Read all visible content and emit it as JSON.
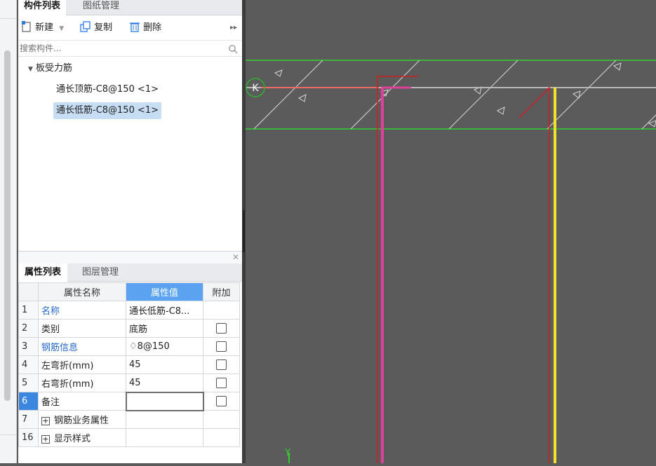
{
  "top_tabs": [
    "构件列表",
    "图纸管理"
  ],
  "toolbar": {
    "new_label": "新建",
    "copy_label": "复制",
    "delete_label": "删除"
  },
  "search": {
    "placeholder": "搜索构件..."
  },
  "tree": {
    "group": "板受力筋",
    "items": [
      "通长顶筋-C8@150 <1>",
      "通长低筋-C8@150 <1>"
    ]
  },
  "prop_tabs": [
    "属性列表",
    "图层管理"
  ],
  "prop_table": {
    "headers": [
      "属性名称",
      "属性值",
      "附加"
    ],
    "rows": [
      {
        "num": "1",
        "name": "名称",
        "value": "通长低筋-C8...",
        "blue": true,
        "check": false
      },
      {
        "num": "2",
        "name": "类别",
        "value": "底筋",
        "blue": false,
        "check": true
      },
      {
        "num": "3",
        "name": "钢筋信息",
        "value": "♢8@150",
        "blue": true,
        "check": true
      },
      {
        "num": "4",
        "name": "左弯折(mm)",
        "value": "45",
        "blue": false,
        "check": true
      },
      {
        "num": "5",
        "name": "右弯折(mm)",
        "value": "45",
        "blue": false,
        "check": true
      },
      {
        "num": "6",
        "name": "备注",
        "value": "",
        "blue": false,
        "check": true
      },
      {
        "num": "7",
        "name": "钢筋业务属性",
        "value": "",
        "blue": false,
        "check": false,
        "expand": true
      },
      {
        "num": "16",
        "name": "显示样式",
        "value": "",
        "blue": false,
        "check": false,
        "expand": true
      }
    ]
  },
  "canvas": {
    "axis_marker": "K",
    "axis_y_label": "Y",
    "slab_line_color": "#2fd12f",
    "top_bar_color": "#e0409a",
    "bottom_bar_color": "#f2e32a",
    "red_line_color": "#cc1f1f"
  }
}
